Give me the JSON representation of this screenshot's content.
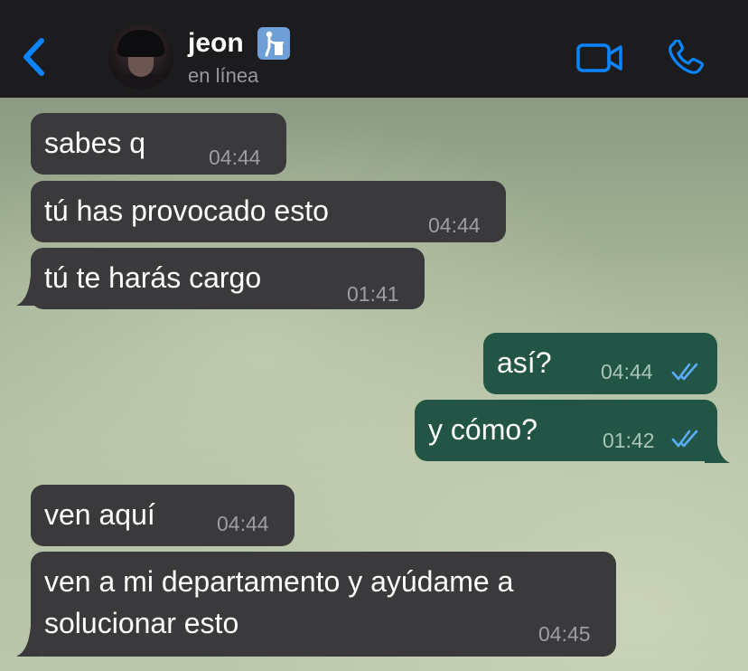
{
  "header": {
    "back_icon": "chevron-left-icon",
    "contact_name": "jeon",
    "name_emoji": "put-litter-in-its-place-emoji",
    "status": "en línea",
    "video_icon": "video-camera-icon",
    "call_icon": "phone-icon",
    "accent_color": "#0a84ff"
  },
  "messages": [
    {
      "direction": "incoming",
      "text": "sabes q",
      "time": "04:44"
    },
    {
      "direction": "incoming",
      "text": "tú has provocado esto",
      "time": "04:44"
    },
    {
      "direction": "incoming",
      "text": "tú te harás cargo",
      "time": "01:41"
    },
    {
      "direction": "outgoing",
      "text": "así?",
      "time": "04:44",
      "read": true
    },
    {
      "direction": "outgoing",
      "text": "y cómo?",
      "time": "01:42",
      "read": true
    },
    {
      "direction": "incoming",
      "text": "ven aquí",
      "time": "04:44"
    },
    {
      "direction": "incoming",
      "text": "ven a mi departamento y ayúdame a\nsolucionar esto",
      "time": "04:45"
    }
  ],
  "colors": {
    "incoming_bubble": "#3a3a3c",
    "outgoing_bubble": "#235547",
    "read_ticks": "#5aaef7"
  }
}
